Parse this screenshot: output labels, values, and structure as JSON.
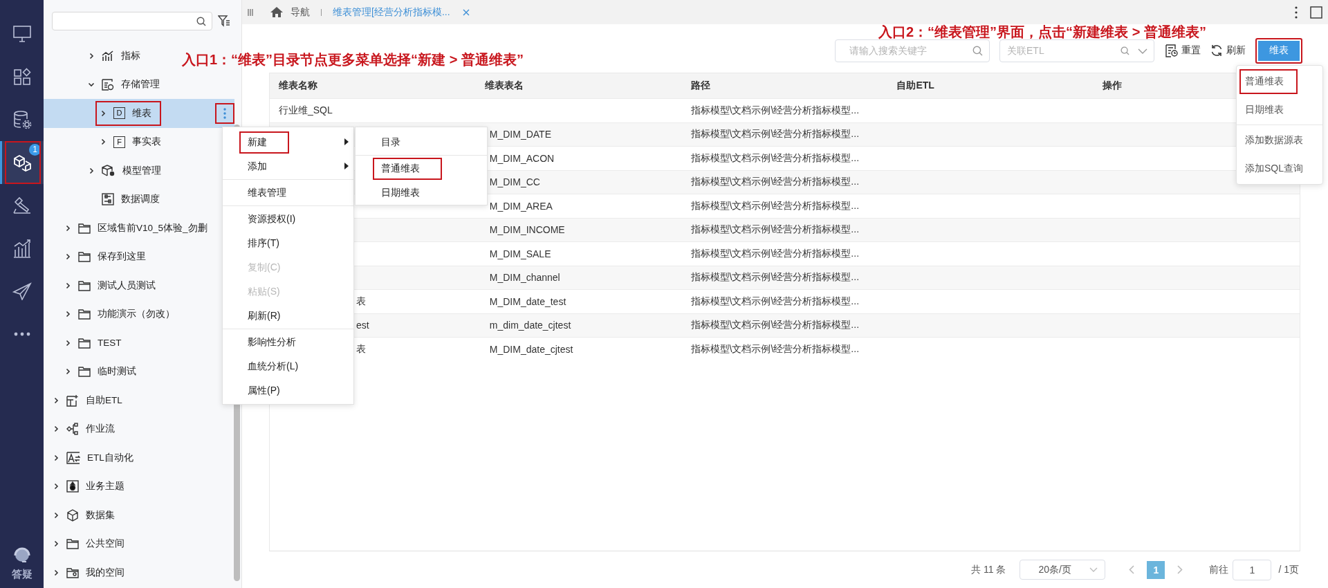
{
  "rail": {
    "items": [
      {
        "kind": "monitor",
        "selected": false
      },
      {
        "kind": "apps",
        "selected": false
      },
      {
        "kind": "database",
        "selected": false
      },
      {
        "kind": "cube",
        "selected": true,
        "badge": "1",
        "highlighted": true
      },
      {
        "kind": "hammer",
        "selected": false
      },
      {
        "kind": "chart",
        "selected": false
      },
      {
        "kind": "send",
        "selected": false
      },
      {
        "kind": "more",
        "selected": false
      }
    ],
    "help": {
      "label": "答疑"
    }
  },
  "tree": [
    {
      "children": [
        {
          "children": [
            {
              "children": [
                {
                  "label": "指标",
                  "kind": "metric",
                  "expanded": false,
                  "selected": false
                },
                {
                  "label": "存储管理",
                  "kind": "storage",
                  "expanded": true,
                  "selected": false,
                  "children": [
                    {
                      "label": "维表",
                      "kind": "letter",
                      "icon_text": "D",
                      "expanded": false,
                      "selected": true,
                      "highlighted": true,
                      "more_highlighted": true
                    },
                    {
                      "label": "事实表",
                      "kind": "letter",
                      "icon_text": "F",
                      "expanded": false,
                      "selected": false
                    }
                  ]
                },
                {
                  "label": "模型管理",
                  "kind": "model",
                  "expanded": false,
                  "selected": false
                },
                {
                  "label": "数据调度",
                  "kind": "schedule",
                  "selected": false
                }
              ]
            }
          ]
        },
        {
          "label": "区域售前V10_5体验_勿删",
          "kind": "folder",
          "expanded": false,
          "selected": false
        },
        {
          "label": "保存到这里",
          "kind": "folder",
          "expanded": false,
          "selected": false
        },
        {
          "label": "测试人员测试",
          "kind": "folder",
          "expanded": false,
          "selected": false
        },
        {
          "label": "功能演示（勿改）",
          "kind": "folder",
          "expanded": false,
          "selected": false
        },
        {
          "label": "TEST",
          "kind": "folder",
          "expanded": false,
          "selected": false
        },
        {
          "label": "临时测试",
          "kind": "folder",
          "expanded": false,
          "selected": false
        }
      ]
    },
    {
      "label": "自助ETL",
      "kind": "etl",
      "expanded": false,
      "selected": false
    },
    {
      "label": "作业流",
      "kind": "flow",
      "expanded": false,
      "selected": false
    },
    {
      "label": "ETL自动化",
      "kind": "etl-auto",
      "expanded": false,
      "selected": false
    },
    {
      "label": "业务主题",
      "kind": "topic",
      "expanded": false,
      "selected": false
    },
    {
      "label": "数据集",
      "kind": "dataset",
      "expanded": false,
      "selected": false
    },
    {
      "label": "公共空间",
      "kind": "folder",
      "expanded": false,
      "selected": false
    },
    {
      "label": "我的空间",
      "kind": "user-folder",
      "expanded": false,
      "selected": false
    }
  ],
  "tab_bar": {
    "nav": {
      "label": "导航"
    },
    "tabs": [
      {
        "label": "维表管理[经营分析指标模...",
        "selected": true
      }
    ]
  },
  "annotations": [
    {
      "text": "入口1：“维表”目录节点更多菜单选择“新建 > 普通维表”"
    },
    {
      "text": "入口2：“维表管理”界面，点击“新建维表 > 普通维表”"
    }
  ],
  "toolbar": {
    "search": {
      "placeholder": "请输入搜索关键字"
    },
    "etl_select": {
      "placeholder": "关联ETL"
    },
    "buttons": [
      {
        "label": "重置",
        "kind": "reset"
      },
      {
        "label": "刷新",
        "kind": "refresh"
      }
    ],
    "primary": {
      "label": "维表",
      "highlighted": true
    },
    "dropdown": [
      [
        {
          "label": "普通维表",
          "highlighted": true
        },
        {
          "label": "日期维表",
          "highlighted": false
        }
      ],
      [
        {
          "label": "添加数据源表",
          "highlighted": false
        },
        {
          "label": "添加SQL查询",
          "highlighted": false
        }
      ]
    ]
  },
  "table": {
    "columns": [
      "维表名称",
      "维表表名",
      "路径",
      "自助ETL",
      "操作"
    ],
    "rows": [
      {
        "name": "行业维_SQL",
        "path": "指标模型\\文档示例\\经营分析指标模型..."
      },
      {
        "table_name": "M_DIM_DATE",
        "path": "指标模型\\文档示例\\经营分析指标模型..."
      },
      {
        "table_name": "M_DIM_ACON",
        "path": "指标模型\\文档示例\\经营分析指标模型..."
      },
      {
        "table_name": "M_DIM_CC",
        "path": "指标模型\\文档示例\\经营分析指标模型..."
      },
      {
        "table_name": "M_DIM_AREA",
        "path": "指标模型\\文档示例\\经营分析指标模型..."
      },
      {
        "table_name": "M_DIM_INCOME",
        "path": "指标模型\\文档示例\\经营分析指标模型..."
      },
      {
        "table_name": "M_DIM_SALE",
        "path": "指标模型\\文档示例\\经营分析指标模型..."
      },
      {
        "table_name": "M_DIM_channel",
        "path": "指标模型\\文档示例\\经营分析指标模型..."
      },
      {
        "name": "表",
        "table_name": "M_DIM_date_test",
        "path": "指标模型\\文档示例\\经营分析指标模型..."
      },
      {
        "name": "est",
        "table_name": "m_dim_date_cjtest",
        "path": "指标模型\\文档示例\\经营分析指标模型..."
      },
      {
        "name": "表",
        "table_name": "M_DIM_date_cjtest",
        "path": "指标模型\\文档示例\\经营分析指标模型..."
      }
    ]
  },
  "pagination": {
    "total": "共 11 条",
    "page_size": "20条/页",
    "pages": [
      {
        "label": "1",
        "selected": true
      }
    ],
    "goto_label": "前往",
    "goto_value": "1",
    "page_count": "/ 1页"
  },
  "context_menu": {
    "groups": [
      [
        {
          "label": "新建",
          "submenu": true,
          "disabled": false,
          "highlighted": true
        },
        {
          "label": "添加",
          "submenu": true,
          "disabled": false,
          "highlighted": false
        }
      ],
      [
        {
          "label": "维表管理",
          "submenu": false,
          "disabled": false,
          "highlighted": false
        }
      ],
      [
        {
          "label": "资源授权(I)",
          "submenu": false,
          "disabled": false,
          "highlighted": false
        },
        {
          "label": "排序(T)",
          "submenu": false,
          "disabled": false,
          "highlighted": false
        },
        {
          "label": "复制(C)",
          "submenu": false,
          "disabled": true,
          "highlighted": false
        },
        {
          "label": "粘贴(S)",
          "submenu": false,
          "disabled": true,
          "highlighted": false
        },
        {
          "label": "刷新(R)",
          "submenu": false,
          "disabled": false,
          "highlighted": false
        }
      ],
      [
        {
          "label": "影响性分析",
          "submenu": false,
          "disabled": false,
          "highlighted": false
        },
        {
          "label": "血统分析(L)",
          "submenu": false,
          "disabled": false,
          "highlighted": false
        },
        {
          "label": "属性(P)",
          "submenu": false,
          "disabled": false,
          "highlighted": false
        }
      ]
    ],
    "submenu": [
      [
        {
          "label": "目录",
          "highlighted": false
        }
      ],
      [
        {
          "label": "普通维表",
          "highlighted": true
        },
        {
          "label": "日期维表",
          "highlighted": false
        }
      ]
    ]
  }
}
